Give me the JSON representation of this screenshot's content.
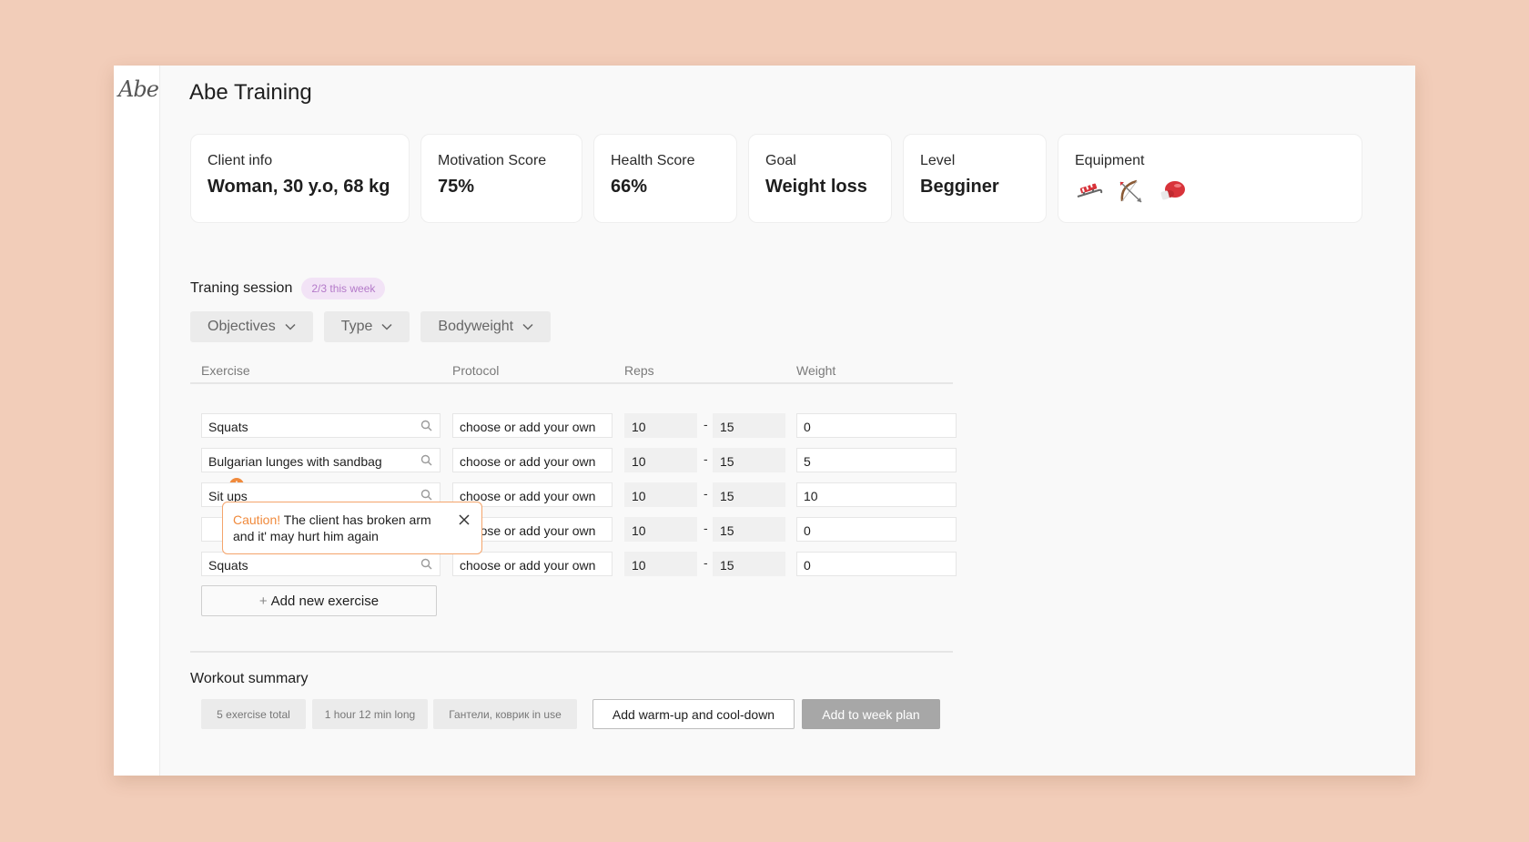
{
  "app": {
    "logo_text": "Abe",
    "title": "Abe Training"
  },
  "cards": [
    {
      "label": "Client info",
      "value": "Woman, 30 y.o, 68 kg"
    },
    {
      "label": "Motivation Score",
      "value": "75%"
    },
    {
      "label": "Health Score",
      "value": "66%"
    },
    {
      "label": "Goal",
      "value": "Weight loss"
    },
    {
      "label": "Level",
      "value": "Begginer"
    },
    {
      "label": "Equipment",
      "icons": [
        "sled-icon",
        "bow-and-arrow-icon",
        "boxing-glove-icon"
      ]
    }
  ],
  "session": {
    "title": "Traning session",
    "badge": "2/3 this week"
  },
  "filters": [
    "Objectives",
    "Type",
    "Bodyweight"
  ],
  "table": {
    "headers": {
      "exercise": "Exercise",
      "protocol": "Protocol",
      "reps": "Reps",
      "weight": "Weight"
    },
    "dash": "-",
    "rows": [
      {
        "exercise": "Squats",
        "protocol": "choose or add your own",
        "reps_min": "10",
        "reps_max": "15",
        "weight": "0"
      },
      {
        "exercise": "Bulgarian lunges with sandbag",
        "protocol": "choose or add your own",
        "reps_min": "10",
        "reps_max": "15",
        "weight": "5"
      },
      {
        "exercise": "Sit ups",
        "protocol": "choose or add your own",
        "reps_min": "10",
        "reps_max": "15",
        "weight": "10"
      },
      {
        "exercise": "",
        "protocol": "choose or add your own",
        "reps_min": "10",
        "reps_max": "15",
        "weight": "0"
      },
      {
        "exercise": "Squats",
        "protocol": "choose or add your own",
        "reps_min": "10",
        "reps_max": "15",
        "weight": "0"
      }
    ]
  },
  "caution": {
    "prefix": "Caution!",
    "text": "The client has broken arm and it' may hurt him again"
  },
  "add_exercise": {
    "plus": "+",
    "label": "Add new exercise"
  },
  "summary": {
    "title": "Workout summary",
    "chips": [
      "5 exercise total",
      "1 hour 12 min long",
      "Гантели, коврик in use"
    ],
    "warmup_button": "Add warm-up and cool-down",
    "add_plan_button": "Add to week plan"
  },
  "colors": {
    "background": "#f2cdb9",
    "accent_orange": "#f08a3c",
    "badge_purple": "#b47ac9"
  }
}
